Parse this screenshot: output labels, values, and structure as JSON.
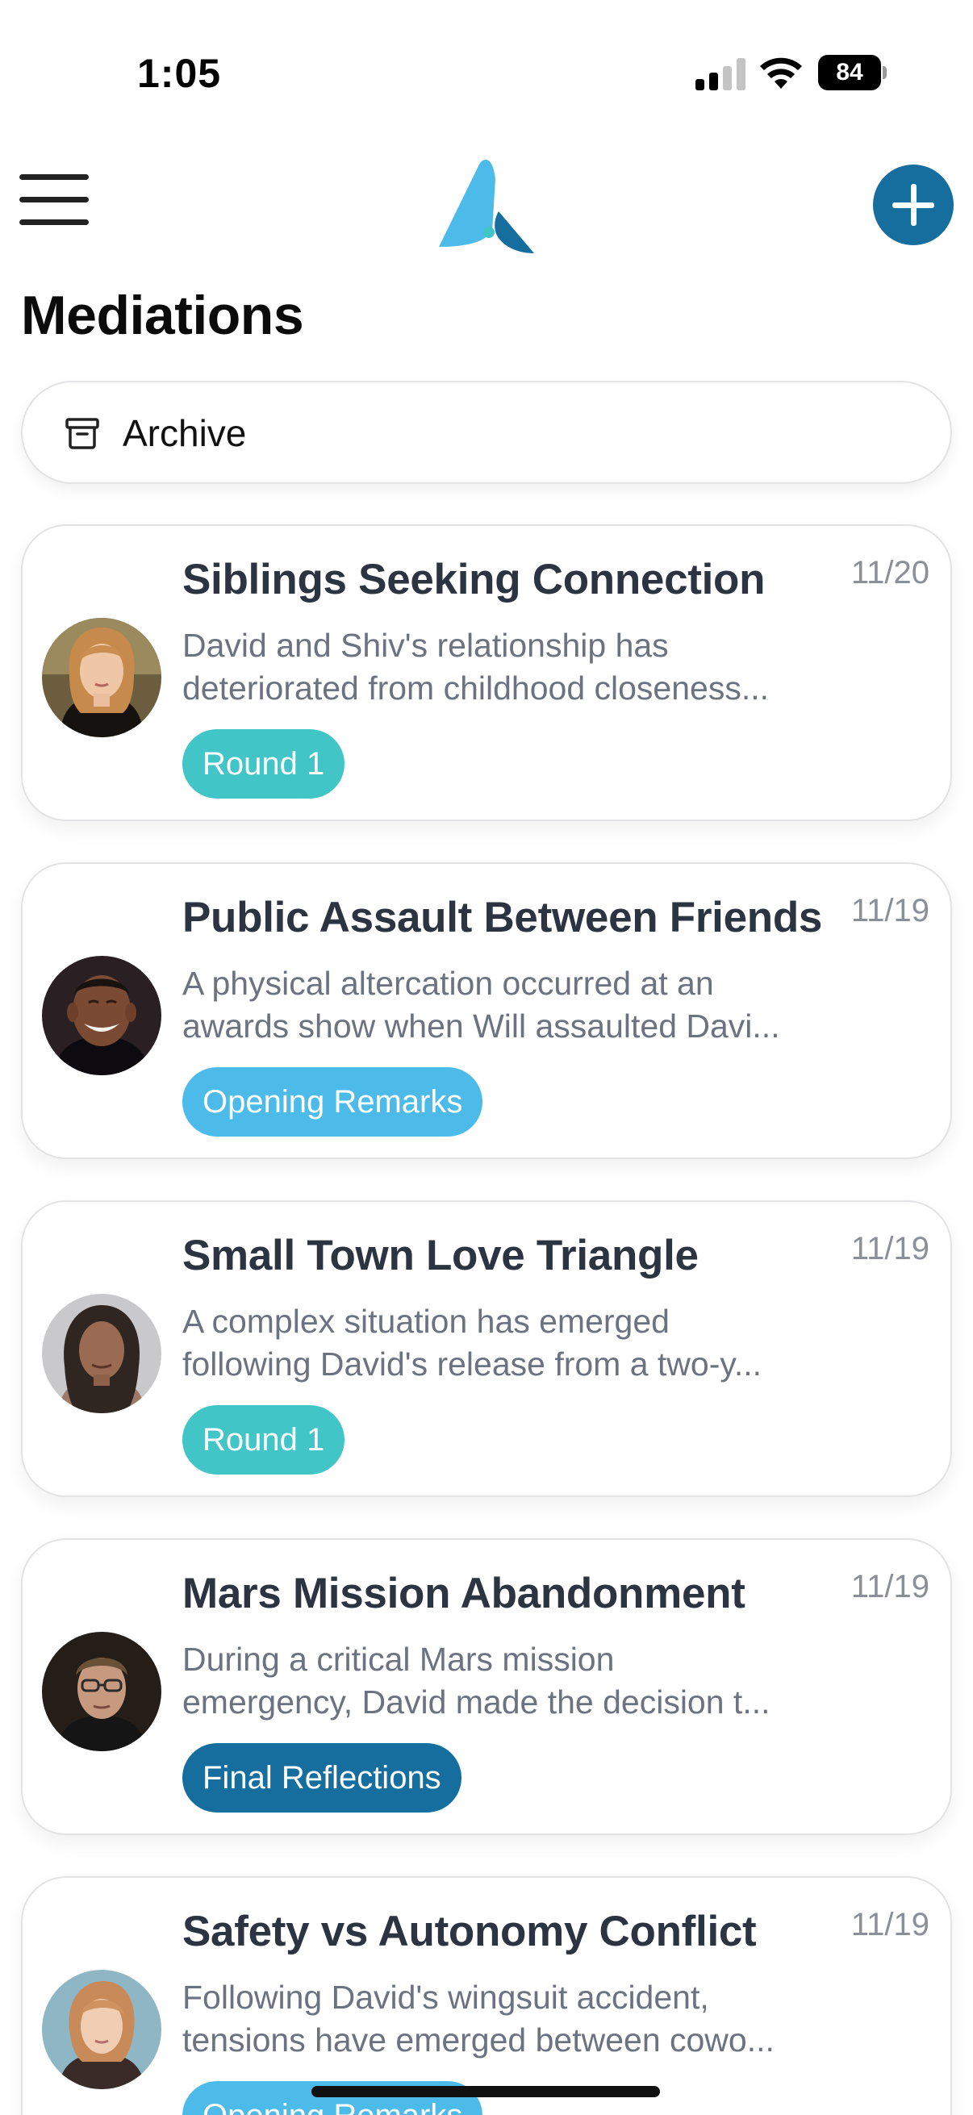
{
  "status_bar": {
    "time": "1:05",
    "battery_level": "84"
  },
  "header": {
    "menu_icon": "hamburger-menu-icon",
    "logo_icon": "app-logo",
    "add_icon": "plus-icon",
    "accent_color": "#166e9e"
  },
  "title": "Mediations",
  "archive": {
    "label": "Archive",
    "icon": "archive-box-icon"
  },
  "mediations": [
    {
      "title": "Siblings Seeking Connection",
      "date": "11/20",
      "desc_line1": "David and Shiv's relationship has",
      "desc_line2": "deteriorated from childhood closeness...",
      "status": "Round 1",
      "status_color": "#41c5c6",
      "avatar": "woman-red-hair-avatar"
    },
    {
      "title": "Public Assault Between Friends",
      "date": "11/19",
      "desc_line1": "A physical altercation occurred at an",
      "desc_line2": "awards show when Will assaulted Davi...",
      "status": "Opening Remarks",
      "status_color": "#4dbbe9",
      "avatar": "smiling-man-avatar"
    },
    {
      "title": "Small Town Love Triangle",
      "date": "11/19",
      "desc_line1": "A complex situation has emerged",
      "desc_line2": "following David's release from a two-y...",
      "status": "Round 1",
      "status_color": "#41c5c6",
      "avatar": "woman-dark-hair-avatar"
    },
    {
      "title": "Mars Mission Abandonment",
      "date": "11/19",
      "desc_line1": "During a critical Mars mission",
      "desc_line2": "emergency, David made the decision t...",
      "status": "Final Reflections",
      "status_color": "#166e9e",
      "avatar": "man-glasses-avatar"
    },
    {
      "title": "Safety vs Autonomy Conflict",
      "date": "11/19",
      "desc_line1": "Following David's wingsuit accident,",
      "desc_line2": "tensions have emerged between cowo...",
      "status": "Opening Remarks",
      "status_color": "#4dbbe9",
      "avatar": "woman-strawberry-blonde-avatar"
    }
  ]
}
